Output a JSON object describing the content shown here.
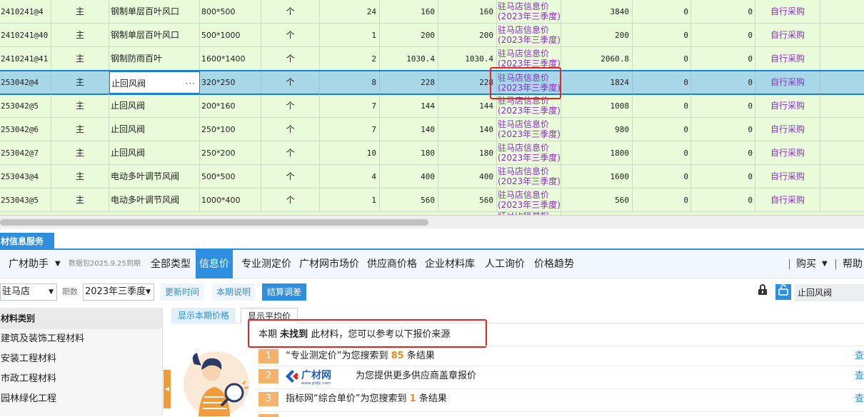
{
  "grid": {
    "rows": [
      {
        "code": "2410241@4",
        "type": "主",
        "name": "钢制单层百叶风口",
        "spec": "800*500",
        "unit": "个",
        "qty": "24",
        "price1": "160",
        "price2": "160",
        "source1": "驻马店信息价",
        "source2": "(2023年三季度)",
        "amount": "3840",
        "z1": "0",
        "z2": "0",
        "buy": "自行采购"
      },
      {
        "code": "2410241@40",
        "type": "主",
        "name": "钢制单层百叶风口",
        "spec": "500*1000",
        "unit": "个",
        "qty": "1",
        "price1": "200",
        "price2": "200",
        "source1": "驻马店信息价",
        "source2": "(2023年三季度)",
        "amount": "200",
        "z1": "0",
        "z2": "0",
        "buy": "自行采购"
      },
      {
        "code": "2410241@41",
        "type": "主",
        "name": "钢制防雨百叶",
        "spec": "1600*1400",
        "unit": "个",
        "qty": "2",
        "price1": "1030.4",
        "price2": "1030.4",
        "source1": "驻马店信息价",
        "source2": "(2023年三季度)",
        "amount": "2060.8",
        "z1": "0",
        "z2": "0",
        "buy": "自行采购"
      },
      {
        "code": "253042@4",
        "type": "主",
        "name": "止回风阀",
        "spec": "320*250",
        "unit": "个",
        "qty": "8",
        "price1": "228",
        "price2": "228",
        "source1": "驻马店信息价",
        "source2": "(2023年三季度)",
        "amount": "1824",
        "z1": "0",
        "z2": "0",
        "buy": "自行采购",
        "selected": true
      },
      {
        "code": "253042@5",
        "type": "主",
        "name": "止回风阀",
        "spec": "200*160",
        "unit": "个",
        "qty": "7",
        "price1": "144",
        "price2": "144",
        "source1": "驻马店信息价",
        "source2": "(2023年三季度)",
        "amount": "1008",
        "z1": "0",
        "z2": "0",
        "buy": "自行采购"
      },
      {
        "code": "253042@6",
        "type": "主",
        "name": "止回风阀",
        "spec": "250*100",
        "unit": "个",
        "qty": "7",
        "price1": "140",
        "price2": "140",
        "source1": "驻马店信息价",
        "source2": "(2023年三季度)",
        "amount": "980",
        "z1": "0",
        "z2": "0",
        "buy": "自行采购"
      },
      {
        "code": "253042@7",
        "type": "主",
        "name": "止回风阀",
        "spec": "250*200",
        "unit": "个",
        "qty": "10",
        "price1": "180",
        "price2": "180",
        "source1": "驻马店信息价",
        "source2": "(2023年三季度)",
        "amount": "1800",
        "z1": "0",
        "z2": "0",
        "buy": "自行采购"
      },
      {
        "code": "253043@4",
        "type": "主",
        "name": "电动多叶调节风阀",
        "spec": "500*500",
        "unit": "个",
        "qty": "4",
        "price1": "400",
        "price2": "400",
        "source1": "驻马店信息价",
        "source2": "(2023年三季度)",
        "amount": "1600",
        "z1": "0",
        "z2": "0",
        "buy": "自行采购"
      },
      {
        "code": "253043@5",
        "type": "主",
        "name": "电动多叶调节风阀",
        "spec": "1000*400",
        "unit": "个",
        "qty": "1",
        "price1": "560",
        "price2": "560",
        "source1": "驻马店信息价",
        "source2": "(2023年三季度)",
        "amount": "560",
        "z1": "0",
        "z2": "0",
        "buy": "自行采购"
      }
    ],
    "partial_row_source": "驻马店信息价"
  },
  "panel": {
    "title": "材信息服务"
  },
  "toolbar": {
    "assistant": "广材助手",
    "package_info": "数据包2025.9.25到期",
    "tabs": [
      "全部类型",
      "信息价",
      "专业测定价",
      "广材网市场价",
      "供应商价格",
      "企业材料库",
      "人工询价",
      "价格趋势"
    ],
    "active_tab": "信息价",
    "buy": "购买",
    "help": "帮助"
  },
  "filter": {
    "region": "驻马店",
    "period_label": "期数",
    "period": "2023年三季度",
    "update_time": "更新时间",
    "period_note": "本期说明",
    "settle_diff": "结算调差",
    "search_value": "止回风阀"
  },
  "categories": {
    "header": "材料类别",
    "items": [
      "建筑及装饰工程材料",
      "安装工程材料",
      "市政工程材料",
      "园林绿化工程"
    ]
  },
  "subtabs": {
    "current": "显示本期价格",
    "average": "显示平均价"
  },
  "notice": {
    "prefix": "本期",
    "bold": "未找到",
    "suffix": "此材料，您可以参考以下报价来源"
  },
  "results": [
    {
      "num": "1",
      "pre": "“专业测定价”为您搜索到",
      "count": "85",
      "post": "条结果",
      "action": "查"
    },
    {
      "num": "2",
      "logo_text": "广材网",
      "logo_sub": "www.gldjc.com",
      "pre": "为您提供更多供应商盖章报价",
      "action": "查"
    },
    {
      "num": "3",
      "pre": "指标网“综合单价”为您搜索到",
      "count": "1",
      "post": "条结果",
      "action": "查"
    }
  ],
  "colors": {
    "grid_bg": "#e9fbd9",
    "selected_row": "#a8d8e8",
    "accent": "#2e8ee0",
    "source_text": "#8a2bd0",
    "highlight_box": "#e8231d",
    "orange": "#f6b26b"
  }
}
